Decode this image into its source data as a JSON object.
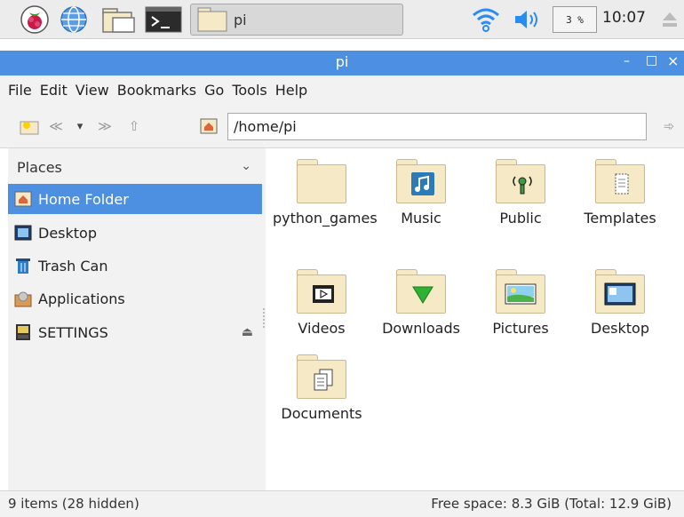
{
  "taskbar": {
    "task_label": "pi",
    "cpu_label": "3 %",
    "clock": "10:07"
  },
  "window": {
    "title": "pi",
    "minimize": "–",
    "maximize": "□",
    "close": "×"
  },
  "menu": [
    "File",
    "Edit",
    "View",
    "Bookmarks",
    "Go",
    "Tools",
    "Help"
  ],
  "toolbar": {
    "path": "/home/pi"
  },
  "sidebar": {
    "header": "Places",
    "items": [
      {
        "label": "Home Folder",
        "icon": "home-icon",
        "selected": true
      },
      {
        "label": "Desktop",
        "icon": "desktop-icon"
      },
      {
        "label": "Trash Can",
        "icon": "trash-icon"
      },
      {
        "label": "Applications",
        "icon": "applications-icon"
      },
      {
        "label": "SETTINGS",
        "icon": "drive-icon"
      }
    ]
  },
  "files": [
    {
      "label": "python_games",
      "icon": "folder-icon"
    },
    {
      "label": "Music",
      "icon": "music-folder-icon"
    },
    {
      "label": "Public",
      "icon": "public-folder-icon"
    },
    {
      "label": "Templates",
      "icon": "templates-folder-icon"
    },
    {
      "label": "Videos",
      "icon": "videos-folder-icon"
    },
    {
      "label": "Downloads",
      "icon": "downloads-folder-icon"
    },
    {
      "label": "Pictures",
      "icon": "pictures-folder-icon"
    },
    {
      "label": "Desktop",
      "icon": "desktop-folder-icon"
    },
    {
      "label": "Documents",
      "icon": "documents-folder-icon"
    }
  ],
  "status": {
    "left": "9 items (28 hidden)",
    "right": "Free space: 8.3 GiB (Total: 12.9 GiB)"
  },
  "colors": {
    "accent": "#4d8fe0",
    "folder": "#f5e9c6"
  }
}
